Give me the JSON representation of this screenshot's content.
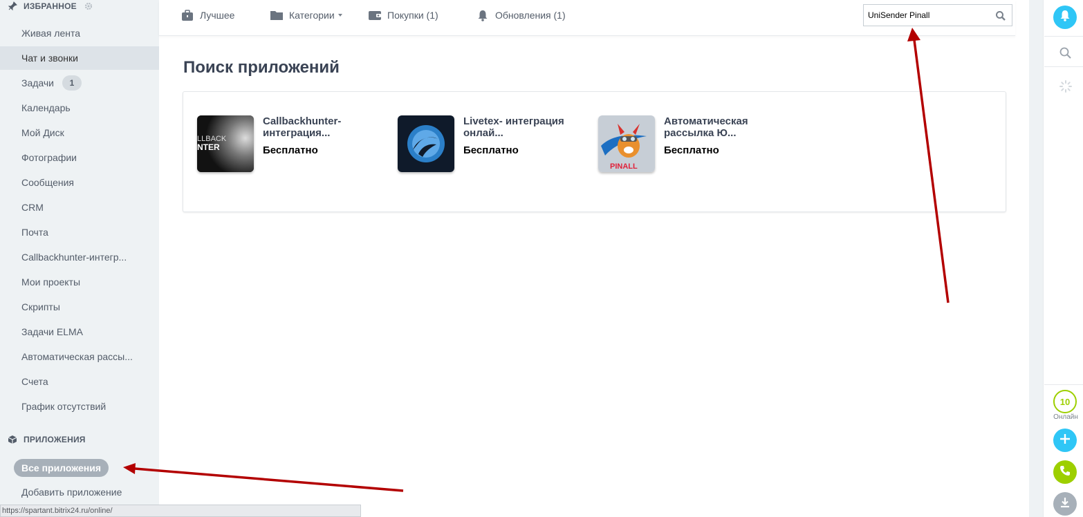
{
  "sidebar": {
    "favorites_header": "ИЗБРАННОЕ",
    "items": [
      {
        "label": "Живая лента"
      },
      {
        "label": "Чат и звонки"
      },
      {
        "label": "Задачи",
        "badge": "1"
      },
      {
        "label": "Календарь"
      },
      {
        "label": "Мой Диск"
      },
      {
        "label": "Фотографии"
      },
      {
        "label": "Сообщения"
      },
      {
        "label": "CRM"
      },
      {
        "label": "Почта"
      },
      {
        "label": "Callbackhunter-интегр..."
      },
      {
        "label": "Мои проекты"
      },
      {
        "label": "Скрипты"
      },
      {
        "label": "Задачи ELMA"
      },
      {
        "label": "Автоматическая рассы..."
      },
      {
        "label": "Счета"
      },
      {
        "label": "График отсутствий"
      }
    ],
    "apps_header": "ПРИЛОЖЕНИЯ",
    "all_apps": "Все приложения",
    "add_app": "Добавить приложение"
  },
  "topnav": {
    "best": "Лучшее",
    "categories": "Категории",
    "purchases": "Покупки (1)",
    "updates": "Обновления (1)",
    "search_value": "UniSender Pinall"
  },
  "main": {
    "title": "Поиск приложений",
    "apps": [
      {
        "name": "Callbackhunter-интеграция...",
        "price": "Бесплатно",
        "logo_text_1": "LLBACK",
        "logo_text_2": "NTER"
      },
      {
        "name": "Livetex- интеграция онлай...",
        "price": "Бесплатно"
      },
      {
        "name": "Автоматическая рассылка Ю...",
        "price": "Бесплатно",
        "logo_text": "PINALL"
      }
    ]
  },
  "rightbar": {
    "online_count": "10",
    "online_label": "Онлайн"
  },
  "statusbar": {
    "url": "https://spartant.bitrix24.ru/online/"
  },
  "colors": {
    "accent_blue": "#2fc6f6",
    "online_green": "#9dcf00",
    "arrow_red": "#b30000"
  }
}
